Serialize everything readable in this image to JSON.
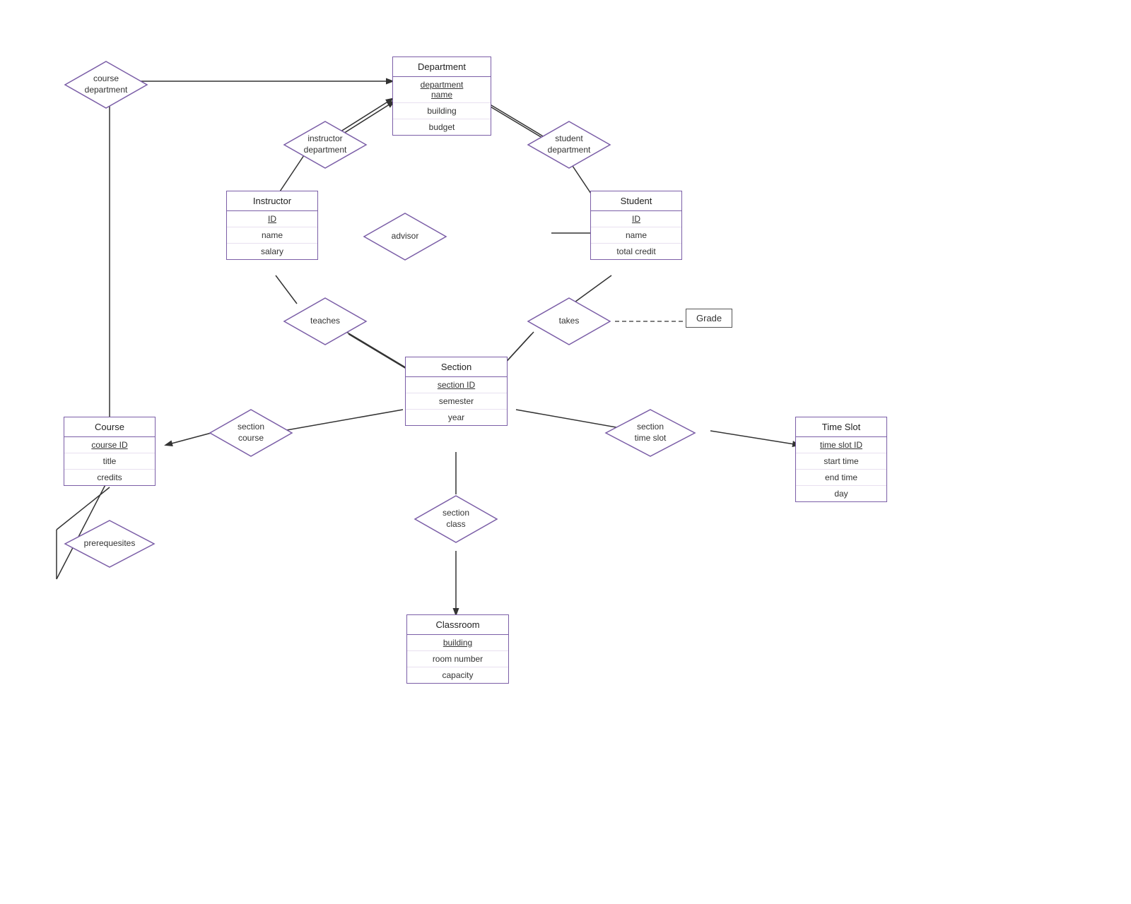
{
  "entities": {
    "department": {
      "title": "Department",
      "attrs": [
        {
          "label": "department name",
          "pk": true
        },
        {
          "label": "building",
          "pk": false
        },
        {
          "label": "budget",
          "pk": false
        }
      ]
    },
    "instructor": {
      "title": "Instructor",
      "attrs": [
        {
          "label": "ID",
          "pk": true
        },
        {
          "label": "name",
          "pk": false
        },
        {
          "label": "salary",
          "pk": false
        }
      ]
    },
    "student": {
      "title": "Student",
      "attrs": [
        {
          "label": "ID",
          "pk": true
        },
        {
          "label": "name",
          "pk": false
        },
        {
          "label": "total credit",
          "pk": false
        }
      ]
    },
    "section": {
      "title": "Section",
      "attrs": [
        {
          "label": "section ID",
          "pk": true
        },
        {
          "label": "semester",
          "pk": false
        },
        {
          "label": "year",
          "pk": false
        }
      ]
    },
    "course": {
      "title": "Course",
      "attrs": [
        {
          "label": "course ID",
          "pk": true
        },
        {
          "label": "title",
          "pk": false
        },
        {
          "label": "credits",
          "pk": false
        }
      ]
    },
    "timeslot": {
      "title": "Time Slot",
      "attrs": [
        {
          "label": "time slot ID",
          "pk": true
        },
        {
          "label": "start time",
          "pk": false
        },
        {
          "label": "end time",
          "pk": false
        },
        {
          "label": "day",
          "pk": false
        }
      ]
    },
    "classroom": {
      "title": "Classroom",
      "attrs": [
        {
          "label": "building",
          "pk": true
        },
        {
          "label": "room number",
          "pk": false
        },
        {
          "label": "capacity",
          "pk": false
        }
      ]
    }
  },
  "relationships": {
    "course_department": "course\ndepartment",
    "instructor_department": "instructor\ndepartment",
    "student_department": "student\ndepartment",
    "advisor": "advisor",
    "teaches": "teaches",
    "takes": "takes",
    "section_course": "section\ncourse",
    "section_timeslot": "section\ntime slot",
    "section_class": "section\nclass",
    "prerequisites": "prerequesites"
  },
  "grade_label": "Grade"
}
